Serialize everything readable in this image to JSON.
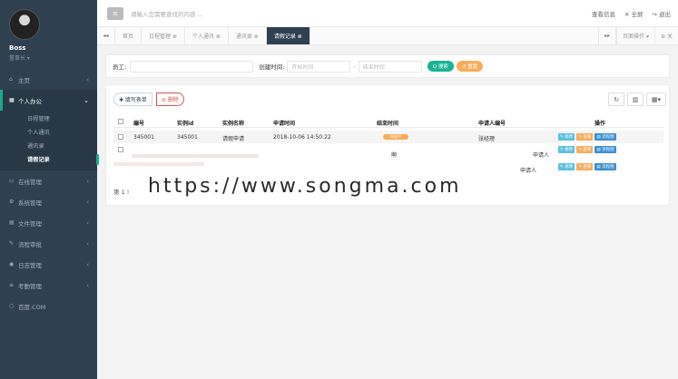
{
  "profile": {
    "name": "Boss",
    "role": "董事长 ▾"
  },
  "sidebar": {
    "items": [
      {
        "label": "主页",
        "icon": "home-icon",
        "glyph": "⌂"
      },
      {
        "label": "个人办公",
        "icon": "calendar-icon",
        "glyph": "▦",
        "active": true
      },
      {
        "label": "在线管理",
        "icon": "monitor-icon",
        "glyph": "▭"
      },
      {
        "label": "系统管理",
        "icon": "gear-icon",
        "glyph": "⚙"
      },
      {
        "label": "文件管理",
        "icon": "file-icon",
        "glyph": "▤"
      },
      {
        "label": "流程审批",
        "icon": "wrench-icon",
        "glyph": "✎"
      },
      {
        "label": "日志管理",
        "icon": "log-icon",
        "glyph": "◉"
      },
      {
        "label": "考勤管理",
        "icon": "sliders-icon",
        "glyph": "≡"
      },
      {
        "label": "百度.COM",
        "icon": "link-icon",
        "glyph": "○"
      }
    ],
    "submenu": [
      "日程管理",
      "个人通讯",
      "通讯录",
      "请假记录"
    ]
  },
  "topbar": {
    "toggle_glyph": "≡",
    "search_placeholder": "请输入您需要查找的内容 ...",
    "right": [
      "查看信息",
      "✕ 全屏",
      "↪ 退出"
    ]
  },
  "tabs": {
    "prev": "◂◂",
    "next": "▸▸",
    "items": [
      {
        "label": "首页"
      },
      {
        "label": "日程管理 ⊗"
      },
      {
        "label": "个人通讯 ⊗"
      },
      {
        "label": "通讯录 ⊗"
      },
      {
        "label": "请假记录 ⊗",
        "active": true
      }
    ],
    "actions": "页面操作 ▾",
    "close": "⊗ 关"
  },
  "filter": {
    "employee_label": "员工:",
    "created_label": "创建时间:",
    "start_placeholder": "开始时间",
    "dash": "-",
    "end_placeholder": "结束时间",
    "search_btn": "Q 搜索",
    "reset_btn": "↺ 重置"
  },
  "toolbar": {
    "add_label": "✚ 填写表单",
    "delete_label": "⊘ 删除",
    "refresh_glyph": "↻",
    "columns_glyph": "▥",
    "export_glyph": "▦▾"
  },
  "table": {
    "headers": [
      "编号",
      "实例id",
      "实例名称",
      "申请时间",
      "结束时间",
      "申请人编号",
      "操作"
    ],
    "rows": [
      {
        "id": "345001",
        "instance": "345001",
        "name": "请假申请",
        "time": "2018-10-06 14:50:22",
        "status": "审批中",
        "applicant": "张经理"
      }
    ],
    "fragment_mid": "啊",
    "fragment_applicant": "申请人",
    "ops": [
      "✎ 修改",
      "✎ 查看",
      "▤ 流程图"
    ],
    "pager": "第 1 !"
  },
  "watermark": "https://www.songma.com"
}
